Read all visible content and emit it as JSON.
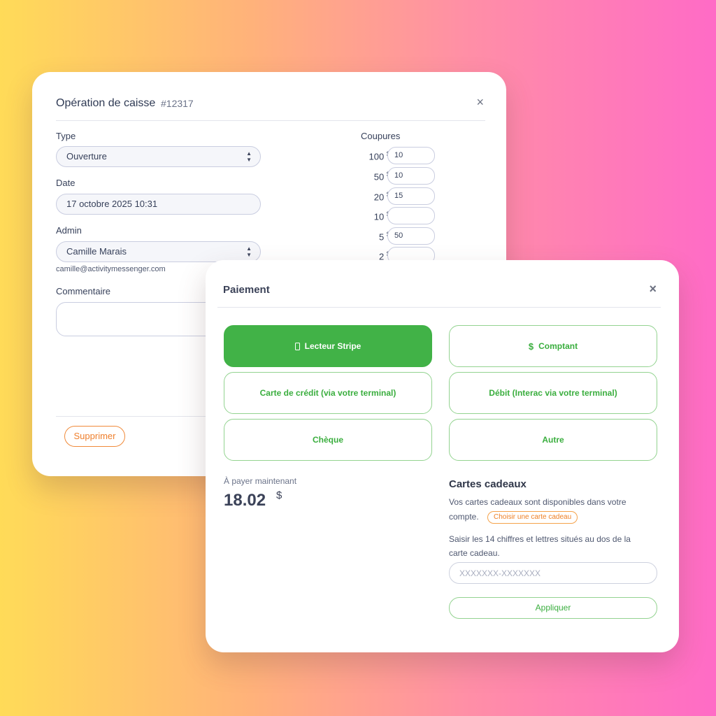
{
  "caisse": {
    "title": "Opération de caisse",
    "number": "#12317",
    "close_icon": "×",
    "type_label": "Type",
    "type_value": "Ouverture",
    "date_label": "Date",
    "date_value": "17 octobre 2025 10:31",
    "admin_label": "Admin",
    "admin_value": "Camille Marais",
    "admin_email": "camille@activitymessenger.com",
    "comment_label": "Commentaire",
    "coupures_title": "Coupures",
    "denominations": [
      {
        "amount": "100",
        "currency": "$",
        "mult": "x",
        "value": "10"
      },
      {
        "amount": "50",
        "currency": "$",
        "mult": "x",
        "value": "10"
      },
      {
        "amount": "20",
        "currency": "$",
        "mult": "x",
        "value": "15"
      },
      {
        "amount": "10",
        "currency": "$",
        "mult": "x",
        "value": ""
      },
      {
        "amount": "5",
        "currency": "$",
        "mult": "x",
        "value": "50"
      },
      {
        "amount": "2",
        "currency": "$",
        "mult": "x",
        "value": ""
      }
    ],
    "delete_label": "Supprimer"
  },
  "paiement": {
    "title": "Paiement",
    "close_icon": "×",
    "methods": {
      "stripe": "Lecteur Stripe",
      "comptant": "Comptant",
      "credit": "Carte de crédit (via votre terminal)",
      "debit": "Débit (Interac via votre terminal)",
      "cheque": "Chèque",
      "autre": "Autre"
    },
    "dollar_icon": "$",
    "a_payer_label": "À payer maintenant",
    "a_payer_amount": "18.02",
    "a_payer_currency": "$",
    "gift_cards": {
      "title": "Cartes cadeaux",
      "available_line1": "Vos cartes cadeaux sont disponibles dans votre",
      "available_line2": "compte.",
      "choose_label": "Choisir une carte cadeau",
      "instructions_line1": "Saisir les 14 chiffres et lettres situés au dos de la",
      "instructions_line2": "carte cadeau.",
      "code_placeholder": "XXXXXXX-XXXXXXX",
      "apply_label": "Appliquer"
    }
  },
  "colors": {
    "accent_green": "#41b247",
    "accent_orange": "#ef7f2c",
    "text_dark": "#2f3a54"
  }
}
